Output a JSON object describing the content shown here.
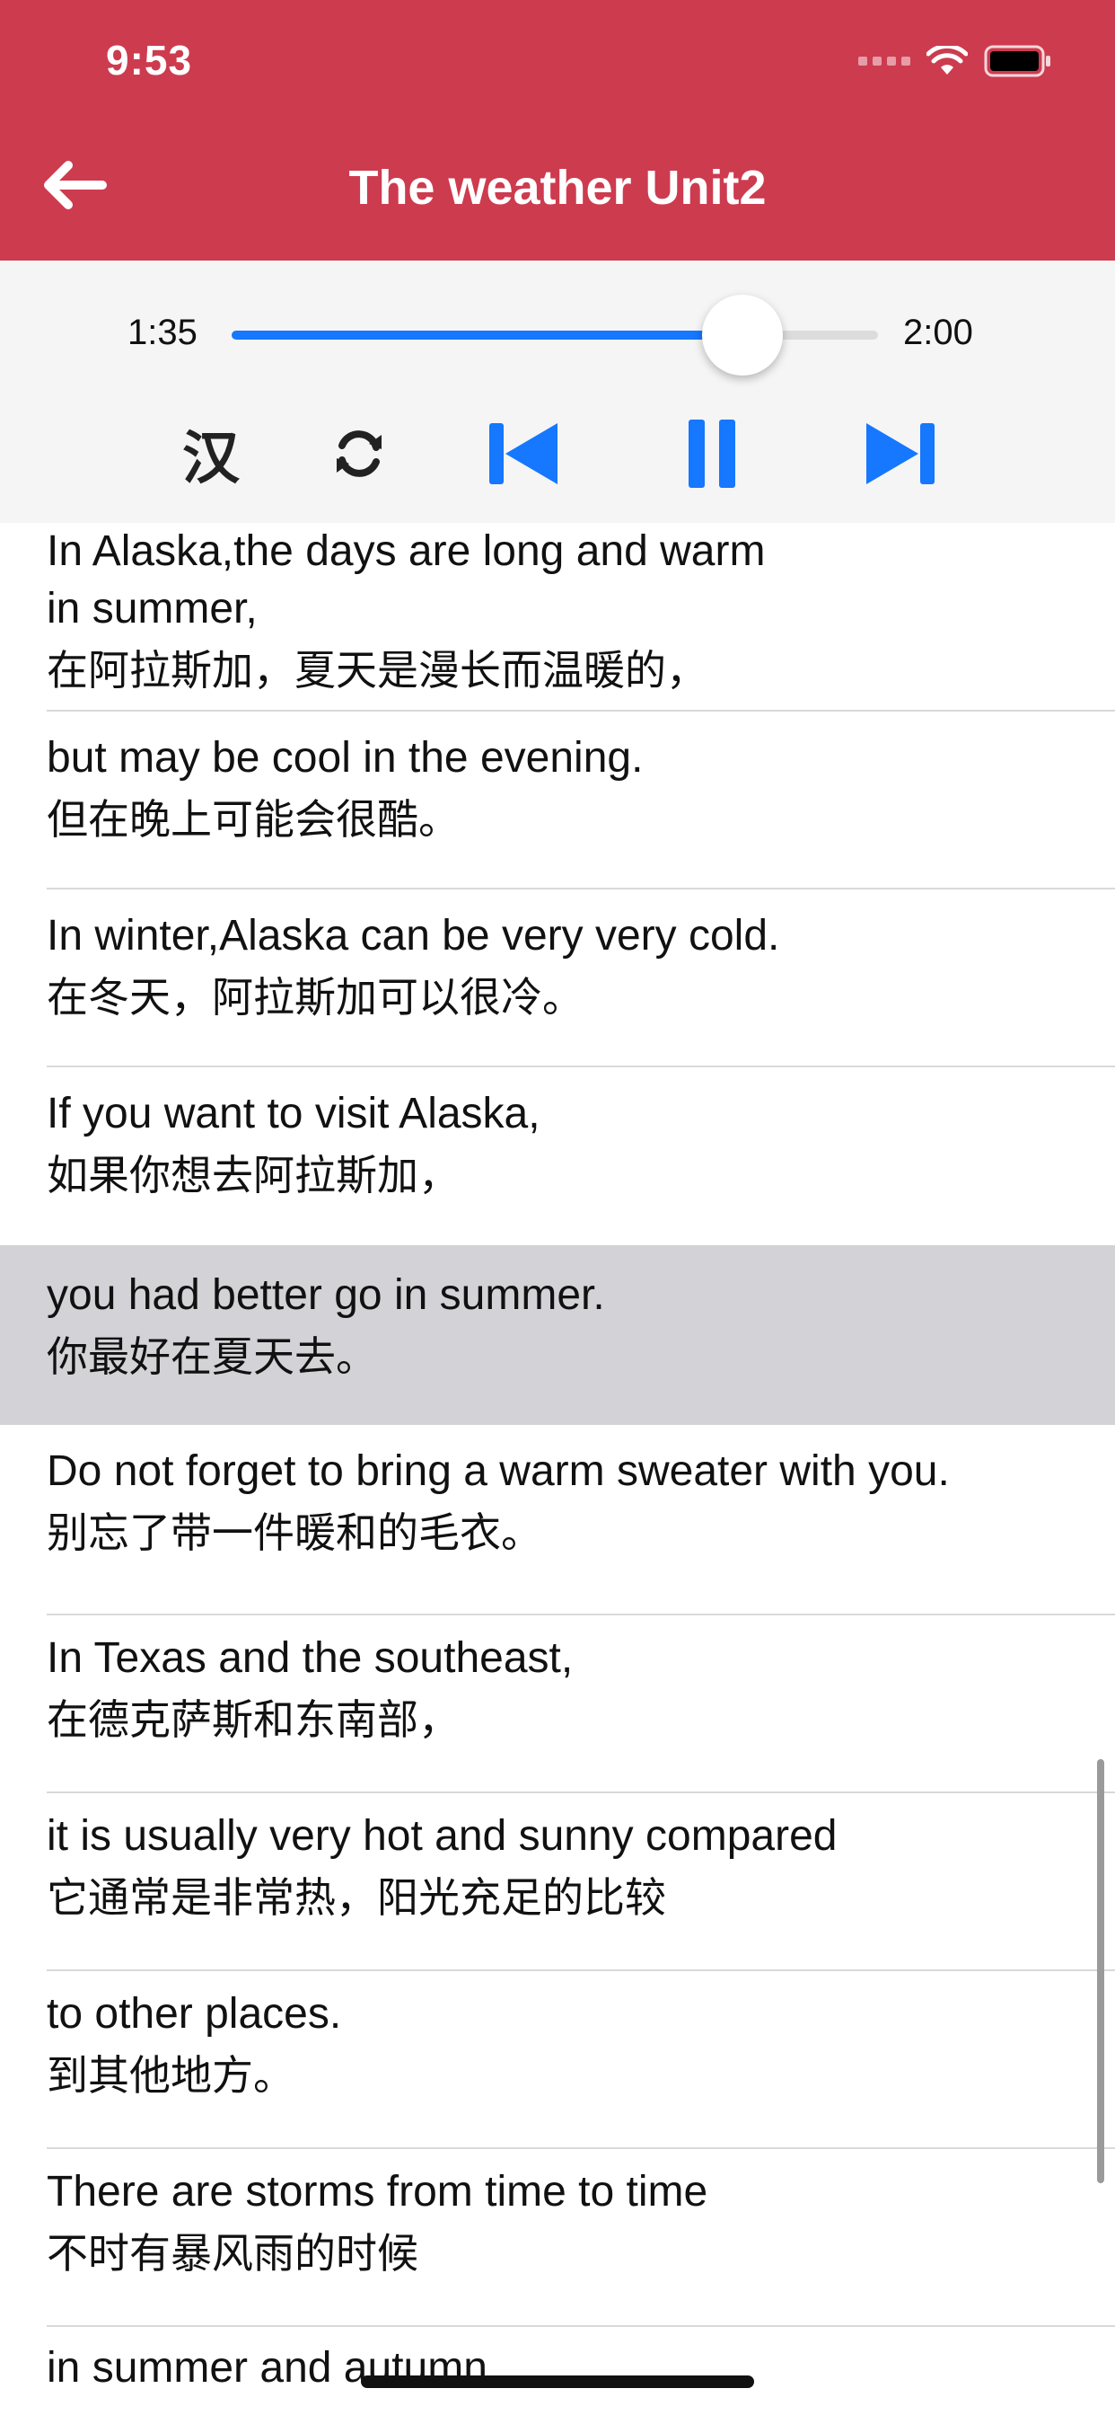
{
  "status_bar": {
    "time": "9:53"
  },
  "header": {
    "title": "The weather Unit2"
  },
  "player": {
    "current_time": "1:35",
    "total_time": "2:00",
    "progress": 0.79,
    "translation_toggle": "汉",
    "accent_color": "#1677ff"
  },
  "lines": [
    {
      "en": "In Alaska,the days are long and warm",
      "en2": "in summer,",
      "zh": "在阿拉斯加，夏天是漫长而温暖的，",
      "active": false
    },
    {
      "en": "but may be cool in the evening.",
      "zh": "但在晚上可能会很酷。",
      "active": false
    },
    {
      "en": "In winter,Alaska can be very very cold.",
      "zh": "在冬天，阿拉斯加可以很冷。",
      "active": false
    },
    {
      "en": "If you want to visit Alaska,",
      "zh": "如果你想去阿拉斯加，",
      "active": false
    },
    {
      "en": "you had better go in summer.",
      "zh": "你最好在夏天去。",
      "active": true
    },
    {
      "en": "Do not forget to bring a warm sweater with you.",
      "zh": "别忘了带一件暖和的毛衣。",
      "active": false
    },
    {
      "en": "In Texas and the southeast,",
      "zh": "在德克萨斯和东南部，",
      "active": false
    },
    {
      "en": "it is usually very hot and sunny compared",
      "zh": "它通常是非常热，阳光充足的比较",
      "active": false
    },
    {
      "en": "to other places.",
      "zh": "到其他地方。",
      "active": false
    },
    {
      "en": "There are storms from time to time",
      "zh": "不时有暴风雨的时候",
      "active": false
    },
    {
      "en": "in summer and autumn.",
      "zh": "",
      "active": false
    }
  ],
  "colors": {
    "header_bg": "#cd3b4f",
    "highlight_bg": "#d2d2d7"
  },
  "icons": {
    "back": "arrow-left-icon",
    "repeat": "repeat-icon",
    "prev": "skip-previous-icon",
    "pause": "pause-icon",
    "next": "skip-next-icon"
  }
}
